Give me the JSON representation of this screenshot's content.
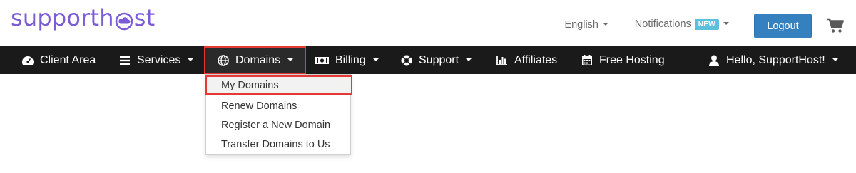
{
  "brand": {
    "logo_text_left": "supporth",
    "logo_text_right": "st",
    "colors": {
      "logo": "#7b5bd6",
      "nav_bg": "#1a1a1a",
      "logout_bg": "#3580be",
      "badge_bg": "#5bc0de",
      "highlight": "#e53935"
    }
  },
  "header": {
    "language_label": "English",
    "notifications_label": "Notifications",
    "notifications_badge": "NEW",
    "logout_label": "Logout",
    "cart_icon": "shopping-cart-icon"
  },
  "nav": {
    "items": [
      {
        "label": "Client Area",
        "icon": "dashboard-icon",
        "has_caret": false
      },
      {
        "label": "Services",
        "icon": "list-icon",
        "has_caret": true
      },
      {
        "label": "Domains",
        "icon": "globe-icon",
        "has_caret": true,
        "active": true
      },
      {
        "label": "Billing",
        "icon": "money-icon",
        "has_caret": true
      },
      {
        "label": "Support",
        "icon": "lifebuoy-icon",
        "has_caret": true
      },
      {
        "label": "Affiliates",
        "icon": "bar-chart-icon",
        "has_caret": false
      },
      {
        "label": "Free Hosting",
        "icon": "calendar-icon",
        "has_caret": false
      }
    ],
    "account": {
      "label": "Hello, SupportHost!",
      "icon": "user-icon",
      "has_caret": true
    }
  },
  "domains_dropdown": {
    "items": [
      {
        "label": "My Domains",
        "highlighted": true
      },
      {
        "label": "Renew Domains"
      },
      {
        "label": "Register a New Domain"
      },
      {
        "label": "Transfer Domains to Us"
      }
    ]
  }
}
